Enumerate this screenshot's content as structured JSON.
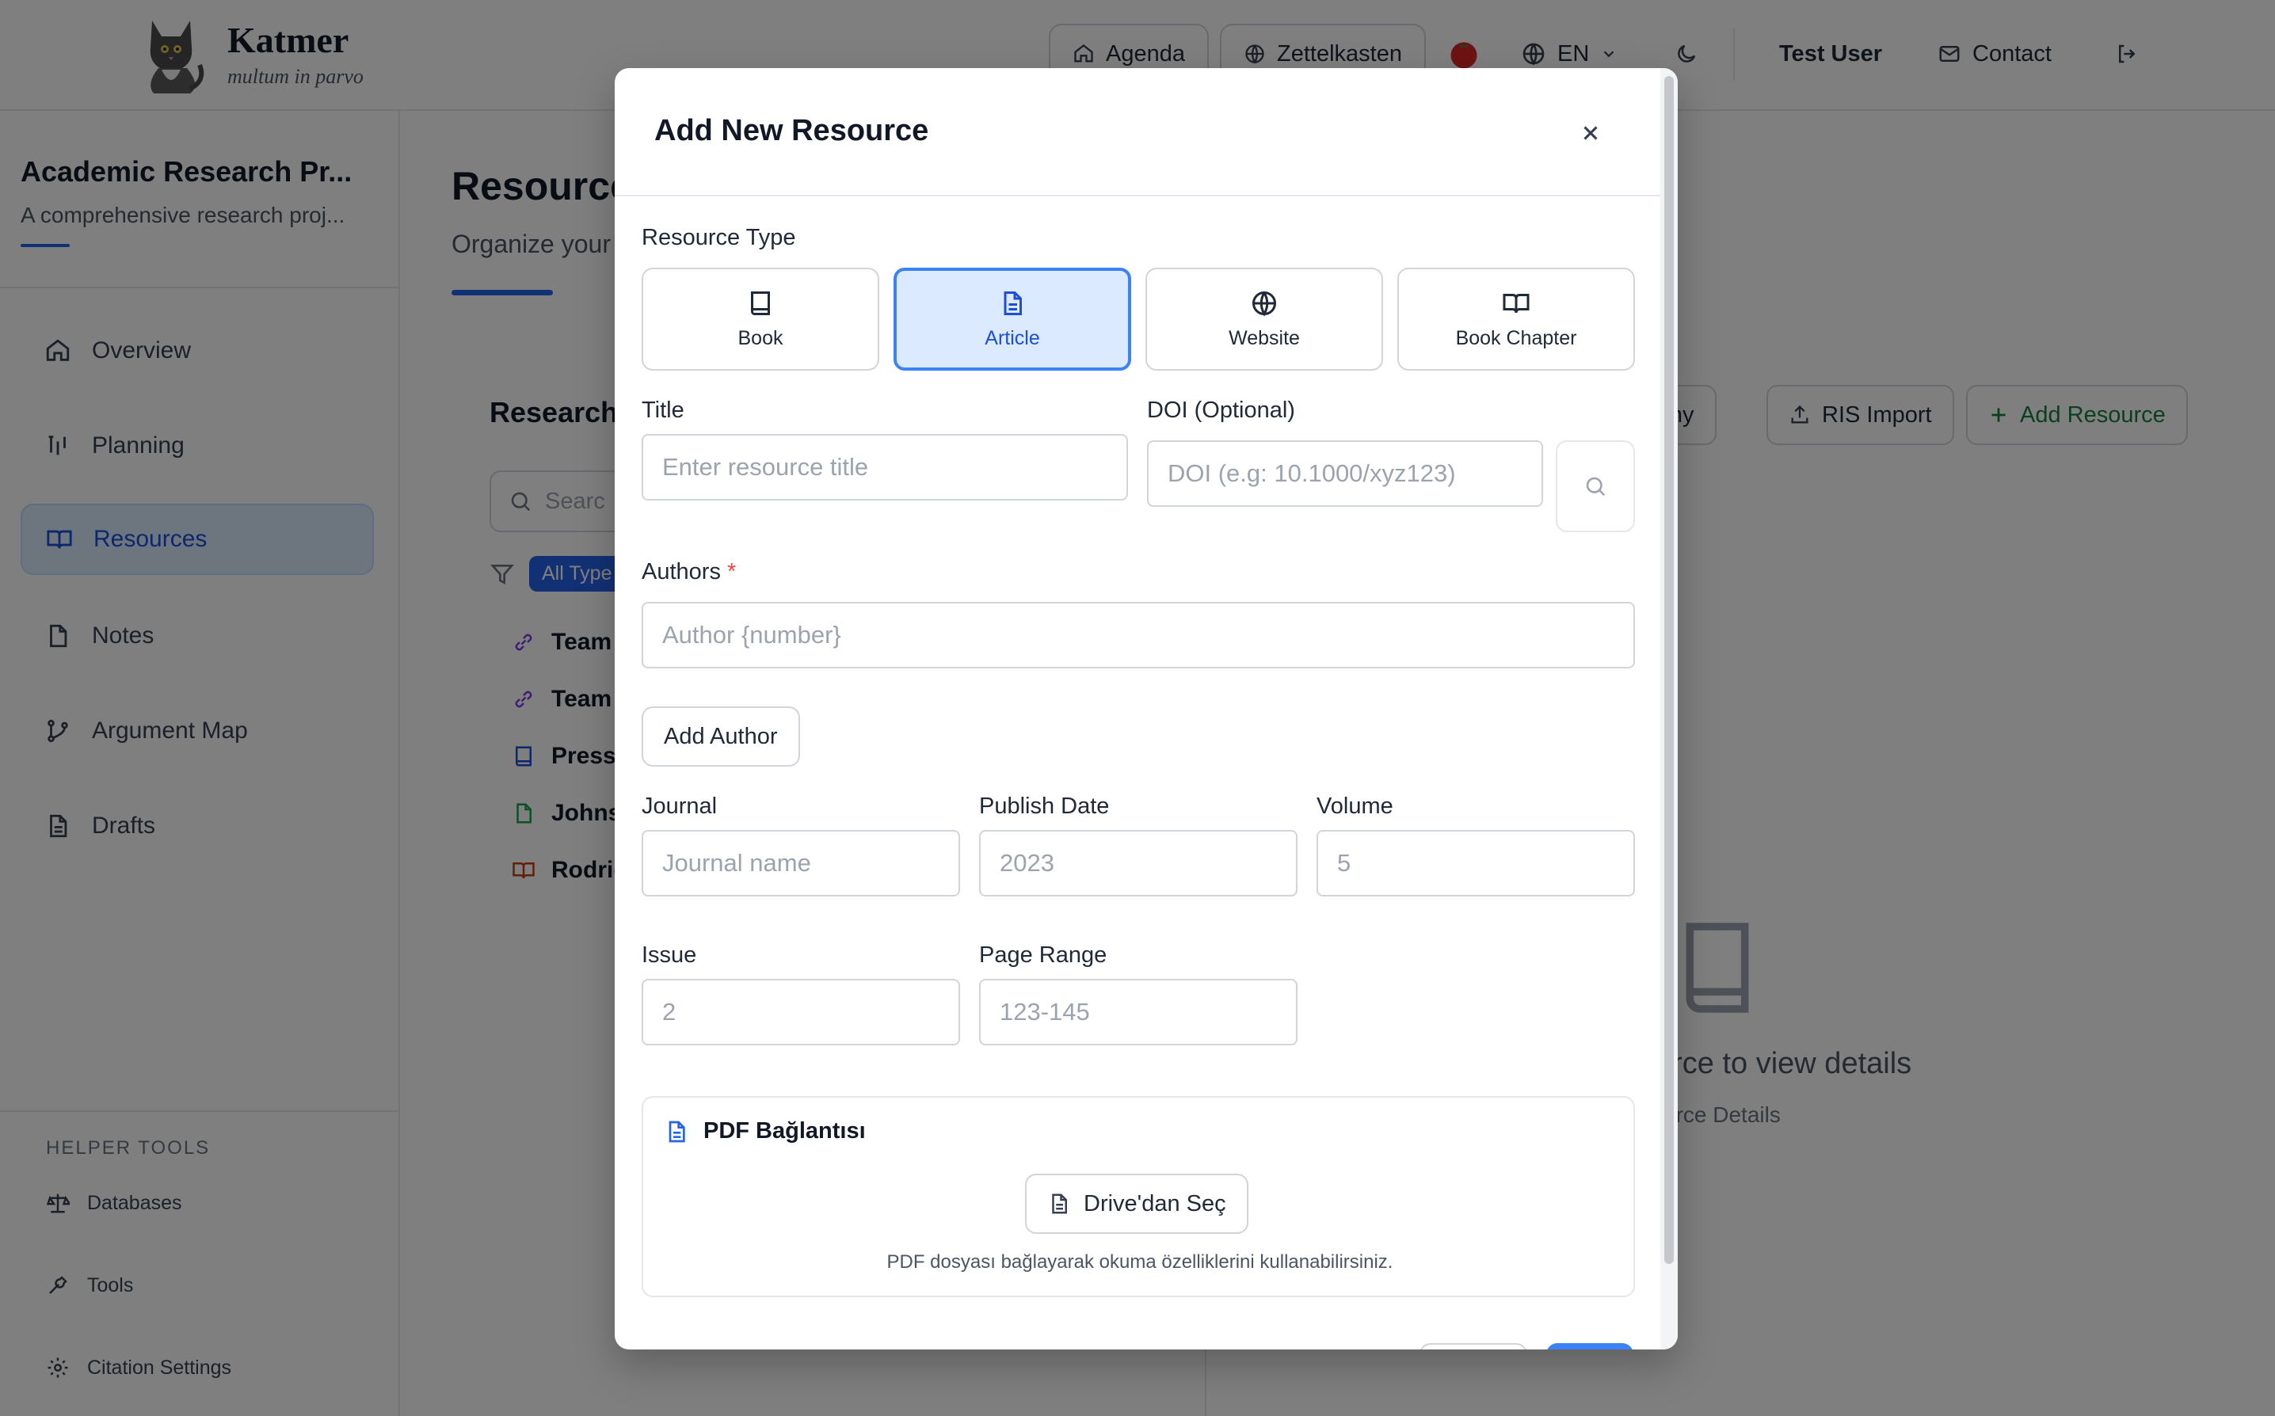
{
  "header": {
    "brand_name": "Katmer",
    "brand_tagline": "multum in parvo",
    "agenda_label": "Agenda",
    "zettelkasten_label": "Zettelkasten",
    "language_label": "EN",
    "user_name": "Test User",
    "contact_label": "Contact"
  },
  "sidebar": {
    "project_title": "Academic Research Pr...",
    "project_description": "A comprehensive research proj...",
    "nav": [
      {
        "label": "Overview",
        "icon": "home-icon"
      },
      {
        "label": "Planning",
        "icon": "planning-icon"
      },
      {
        "label": "Resources",
        "icon": "book-open-icon",
        "active": true
      },
      {
        "label": "Notes",
        "icon": "file-icon"
      },
      {
        "label": "Argument Map",
        "icon": "git-branch-icon"
      },
      {
        "label": "Drafts",
        "icon": "file-text-icon"
      }
    ],
    "helper_label": "HELPER TOOLS",
    "helpers": [
      {
        "label": "Databases",
        "icon": "scale-icon"
      },
      {
        "label": "Tools",
        "icon": "wrench-icon"
      },
      {
        "label": "Citation Settings",
        "icon": "gear-icon"
      }
    ]
  },
  "main": {
    "title": "Resource",
    "description": "Organize your",
    "list_title": "Research",
    "search_placeholder": "Searc",
    "filter_chip": "All Type",
    "resources": [
      {
        "label": "Team",
        "icon": "link-icon",
        "color": "#7c3aed"
      },
      {
        "label": "Team",
        "icon": "link-icon",
        "color": "#7c3aed"
      },
      {
        "label": "Press",
        "icon": "book-icon",
        "color": "#1d4ed8"
      },
      {
        "label": "Johns",
        "icon": "file-icon",
        "color": "#16a34a"
      },
      {
        "label": "Rodrig",
        "icon": "book-open-icon",
        "color": "#c2410c"
      }
    ],
    "bibliography_label": "raphy",
    "ris_import_label": "RIS Import",
    "add_resource_label": "Add Resource",
    "empty_title": "urce to view details",
    "empty_subtitle": "urce Details"
  },
  "modal": {
    "title": "Add New Resource",
    "resource_type_label": "Resource Type",
    "types": [
      {
        "label": "Book",
        "icon": "book-icon"
      },
      {
        "label": "Article",
        "icon": "file-text-icon",
        "selected": true
      },
      {
        "label": "Website",
        "icon": "globe-icon"
      },
      {
        "label": "Book Chapter",
        "icon": "book-open-icon"
      }
    ],
    "title_label": "Title",
    "title_placeholder": "Enter resource title",
    "doi_label": "DOI (Optional)",
    "doi_placeholder": "DOI (e.g: 10.1000/xyz123)",
    "authors_label": "Authors",
    "authors_required_mark": "*",
    "author_placeholder": "Author {number}",
    "add_author_label": "Add Author",
    "journal_label": "Journal",
    "journal_placeholder": "Journal name",
    "publish_date_label": "Publish Date",
    "publish_date_placeholder": "2023",
    "volume_label": "Volume",
    "volume_placeholder": "5",
    "issue_label": "Issue",
    "issue_placeholder": "2",
    "page_range_label": "Page Range",
    "page_range_placeholder": "123-145",
    "pdf_title": "PDF Bağlantısı",
    "drive_button_label": "Drive'dan Seç",
    "pdf_hint": "PDF dosyası bağlayarak okuma özelliklerini kullanabilirsiniz."
  },
  "colors": {
    "accent": "#2563eb",
    "selected_bg": "#dbeafe",
    "required": "#ef4444",
    "success": "#15803d"
  }
}
